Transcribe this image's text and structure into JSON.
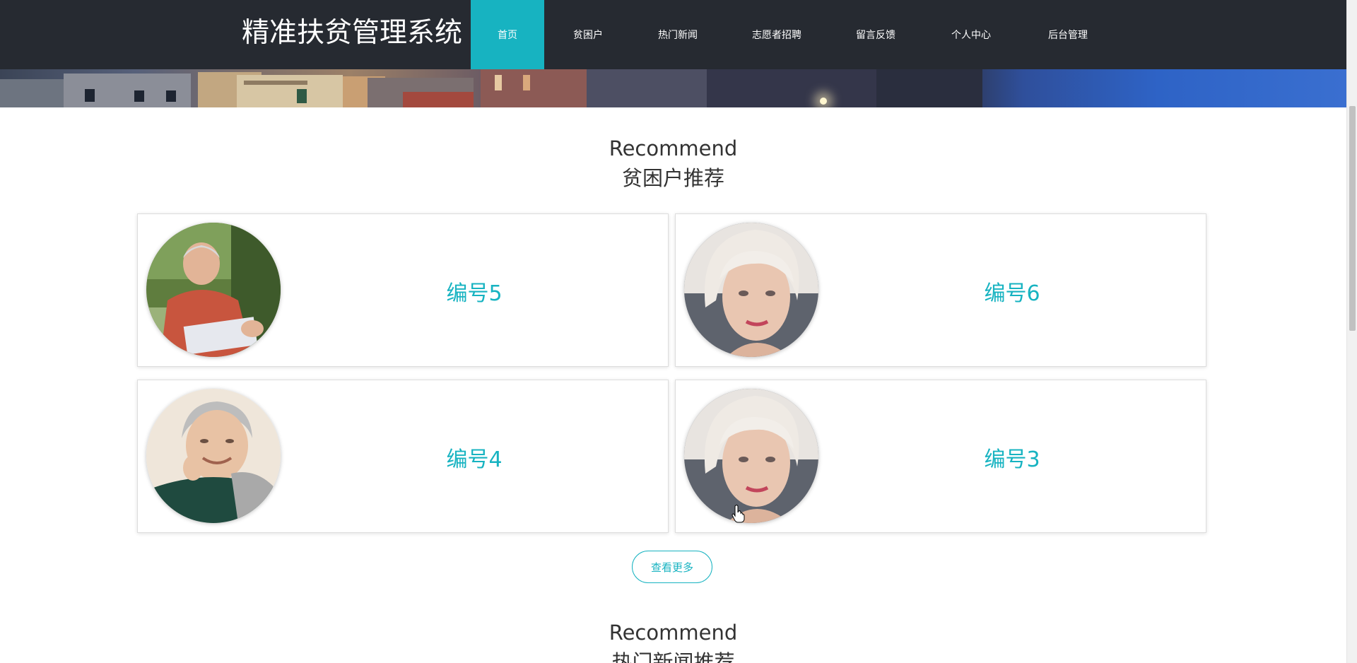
{
  "header": {
    "brand": "精准扶贫管理系统",
    "nav": [
      {
        "label": "首页",
        "active": true
      },
      {
        "label": "贫困户",
        "active": false
      },
      {
        "label": "热门新闻",
        "active": false
      },
      {
        "label": "志愿者招聘",
        "active": false
      },
      {
        "label": "留言反馈",
        "active": false
      },
      {
        "label": "个人中心",
        "active": false
      },
      {
        "label": "后台管理",
        "active": false
      }
    ]
  },
  "recommend_section": {
    "title_en": "Recommend",
    "title_cn": "贫困户推荐",
    "cards": [
      {
        "label": "编号5",
        "avatar": "elderly-man-reading-photo"
      },
      {
        "label": "编号6",
        "avatar": "elderly-woman-portrait-photo"
      },
      {
        "label": "编号4",
        "avatar": "elderly-woman-smiling-photo"
      },
      {
        "label": "编号3",
        "avatar": "elderly-woman-portrait-photo"
      }
    ],
    "more_button": "查看更多"
  },
  "news_section": {
    "title_en": "Recommend",
    "title_cn": "热门新闻推荐"
  },
  "colors": {
    "header_bg": "#262a31",
    "accent": "#17b3c1",
    "text_dark": "#333333"
  }
}
